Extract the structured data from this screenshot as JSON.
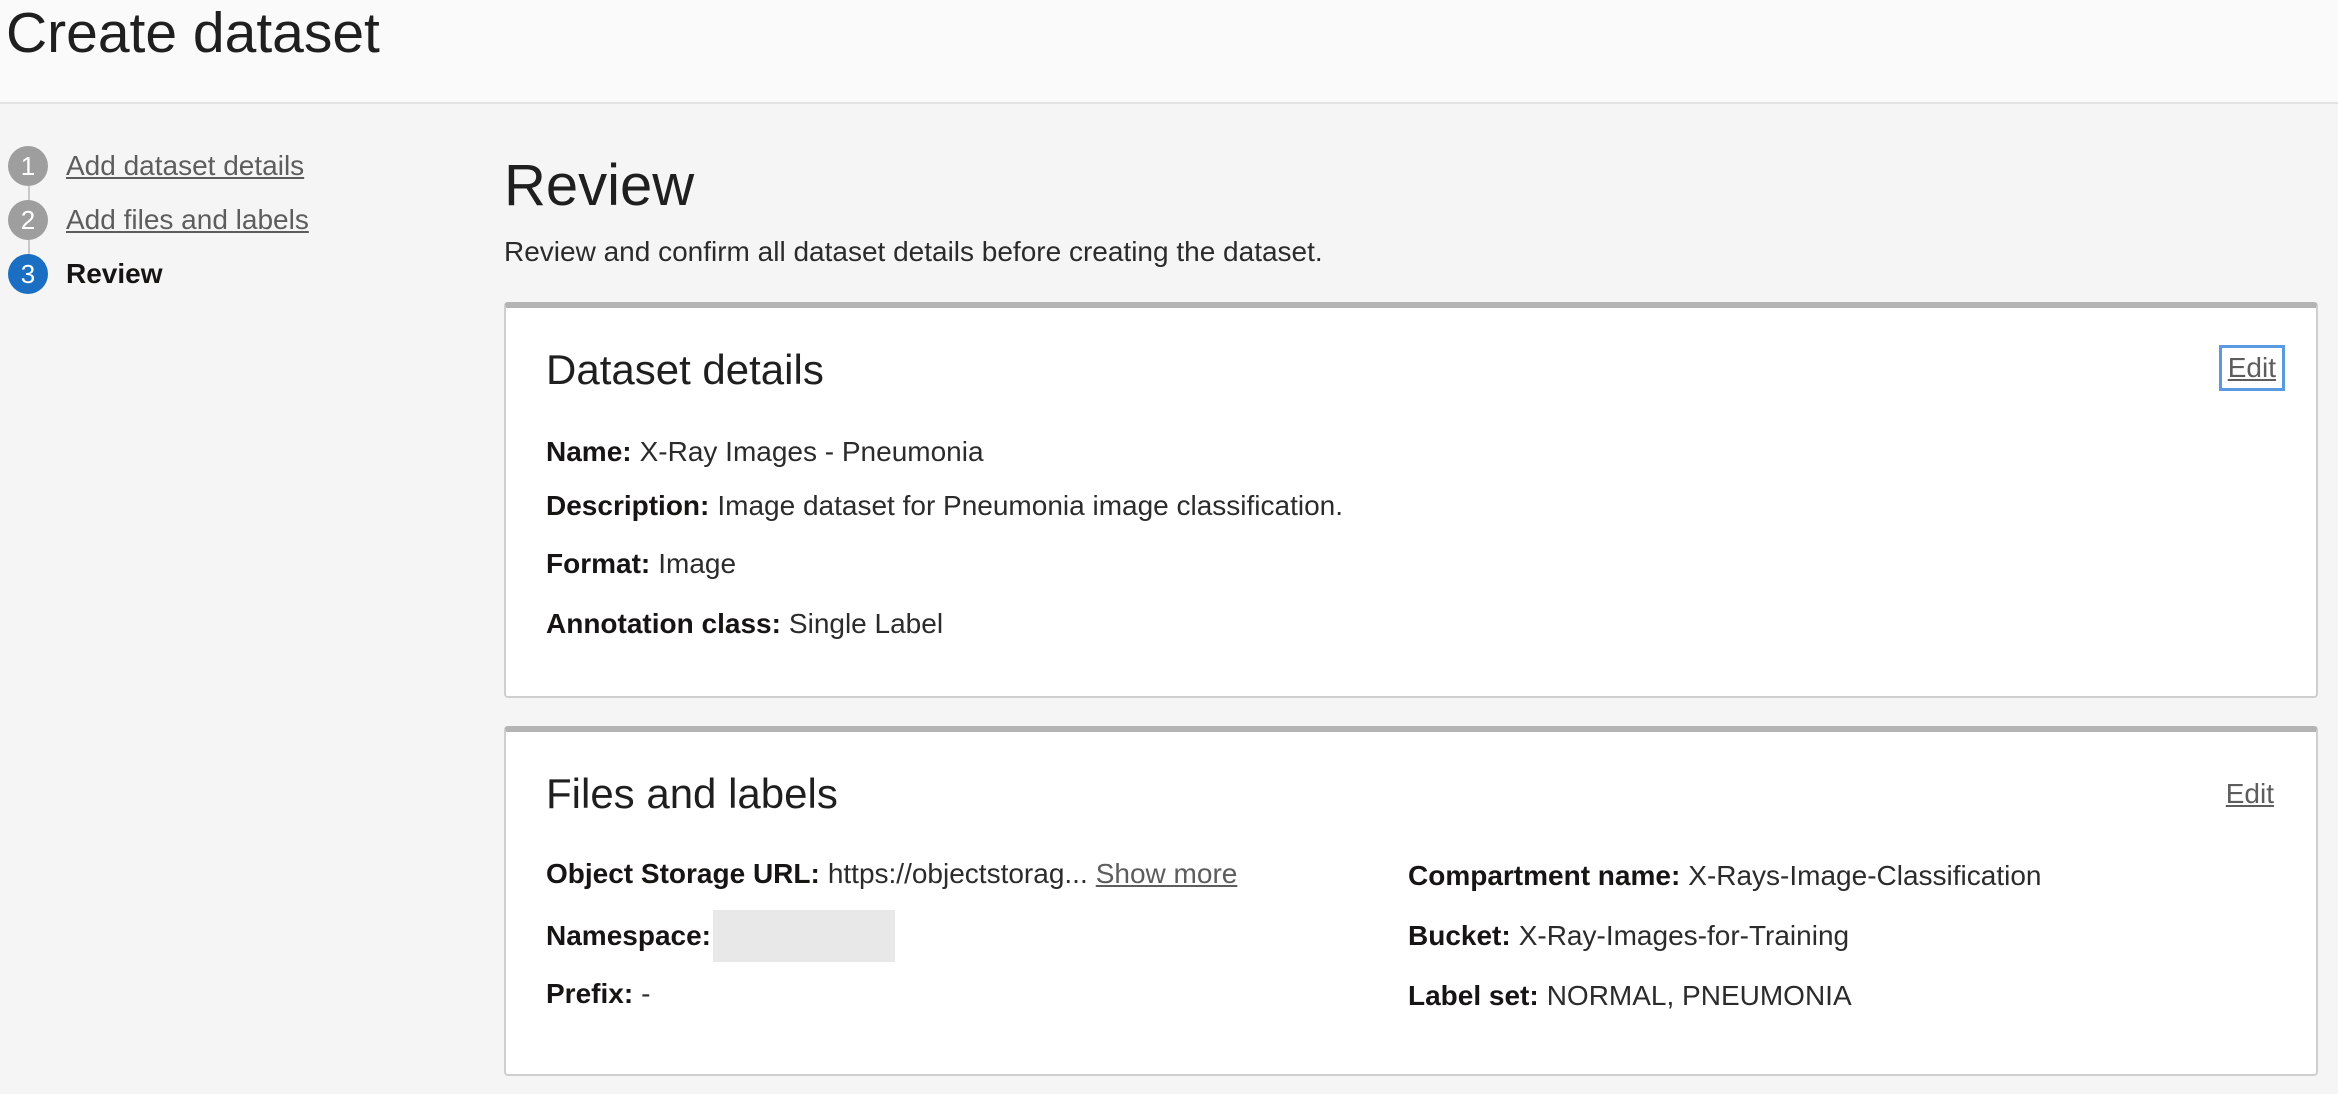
{
  "header": {
    "title": "Create dataset"
  },
  "steps": [
    {
      "number": "1",
      "label": "Add dataset details",
      "state": "completed"
    },
    {
      "number": "2",
      "label": "Add files and labels",
      "state": "completed"
    },
    {
      "number": "3",
      "label": "Review",
      "state": "active"
    }
  ],
  "review": {
    "title": "Review",
    "description": "Review and confirm all dataset details before creating the dataset."
  },
  "dataset_details": {
    "title": "Dataset details",
    "edit_label": "Edit",
    "name_label": "Name:",
    "name_value": "X-Ray Images - Pneumonia",
    "description_label": "Description:",
    "description_value": "Image dataset for Pneumonia image classification.",
    "format_label": "Format:",
    "format_value": "Image",
    "annotation_label": "Annotation class:",
    "annotation_value": "Single Label"
  },
  "files_labels": {
    "title": "Files and labels",
    "edit_label": "Edit",
    "url_label": "Object Storage URL:",
    "url_value": "https://objectstorag...",
    "show_more_label": "Show more",
    "namespace_label": "Namespace:",
    "prefix_label": "Prefix:",
    "prefix_value": "-",
    "compartment_label": "Compartment name:",
    "compartment_value": "X-Rays-Image-Classification",
    "bucket_label": "Bucket:",
    "bucket_value": "X-Ray-Images-for-Training",
    "label_set_label": "Label set:",
    "label_set_value": "NORMAL, PNEUMONIA"
  },
  "colors": {
    "active_step": "#1b6fc2",
    "inactive_step": "#9e9e9e",
    "focus_outline": "#5b9ae0"
  }
}
